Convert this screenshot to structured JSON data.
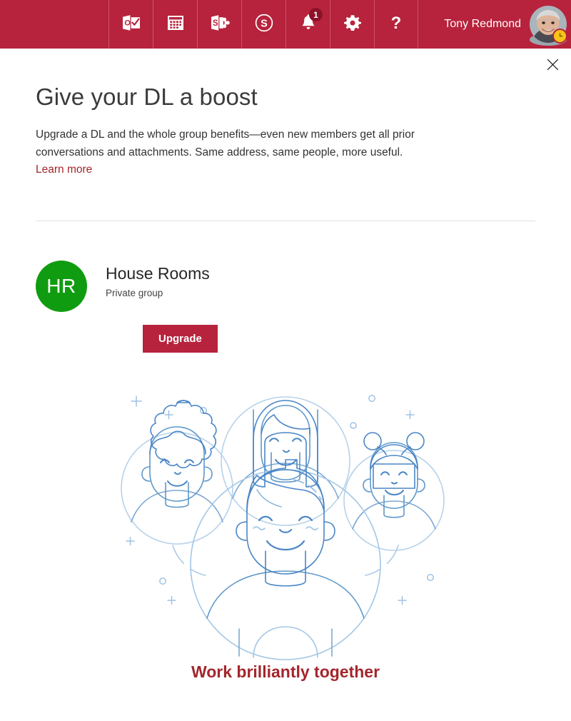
{
  "suite_bar": {
    "background_color": "#b7233c",
    "apps": [
      {
        "name": "outlook-mail-icon",
        "label": "Mail",
        "badge": null
      },
      {
        "name": "calendar-icon",
        "label": "Calendar",
        "badge": null
      },
      {
        "name": "sharepoint-icon",
        "label": "SharePoint",
        "badge": null
      },
      {
        "name": "skype-icon",
        "label": "Skype for Business",
        "badge": null
      },
      {
        "name": "notifications-bell-icon",
        "label": "Notifications",
        "badge": "1"
      },
      {
        "name": "settings-gear-icon",
        "label": "Settings",
        "badge": null
      },
      {
        "name": "help-question-icon",
        "label": "Help",
        "badge": null
      }
    ],
    "user": {
      "display_name": "Tony Redmond",
      "presence": "away",
      "presence_color": "#f5c518"
    }
  },
  "close_button": {
    "label": "Close",
    "icon": "close-x-icon"
  },
  "promo": {
    "headline": "Give your DL a boost",
    "body": "Upgrade a DL and the whole group benefits—even new members get all prior conversations and attachments. Same address, same people, more useful.",
    "learn_more_label": "Learn more",
    "learn_more_color": "#a4262c"
  },
  "group": {
    "initials": "HR",
    "avatar_color": "#109c10",
    "name": "House Rooms",
    "privacy": "Private group",
    "upgrade_button_label": "Upgrade",
    "upgrade_button_color": "#b7233c"
  },
  "illustration": {
    "name": "people-group-line-art",
    "tagline": "Work brilliantly together",
    "tagline_color": "#a4262c",
    "stroke_color": "#3f7fc1"
  }
}
